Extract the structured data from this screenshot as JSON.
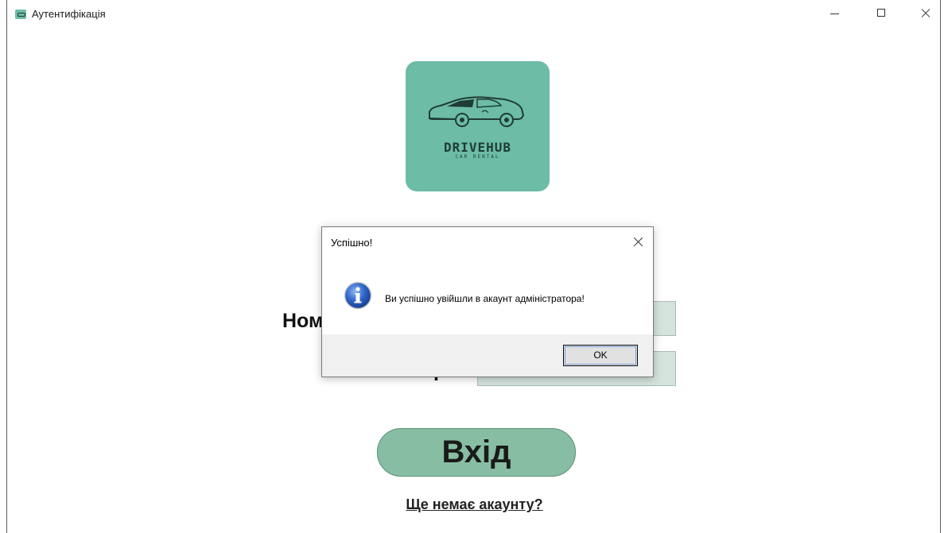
{
  "window": {
    "title": "Аутентифікація"
  },
  "logo": {
    "name": "DRIVEHUB",
    "tagline": "CAR RENTAL"
  },
  "form": {
    "number_label": "Ном",
    "password_label": "р",
    "login_label": "Вхід",
    "signup_link": "Ще немає акаунту?"
  },
  "dialog": {
    "title": "Успішно!",
    "message": "Ви успішно увійшли в акаунт адміністратора!",
    "ok_label": "OK",
    "icon": "info-icon"
  },
  "colors": {
    "brand": "#6cbca6",
    "button": "#87bea3",
    "input_bg": "#d5e3dd"
  }
}
